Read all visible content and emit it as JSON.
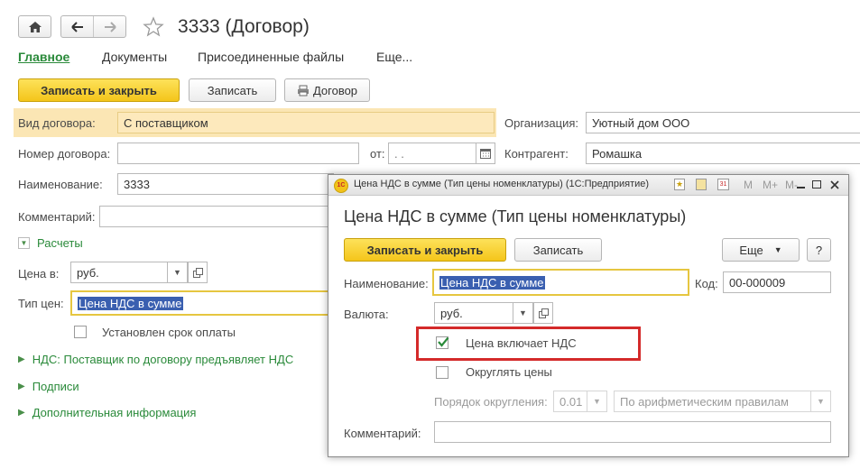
{
  "form": {
    "title": "3333 (Договор)",
    "tabs": [
      "Главное",
      "Документы",
      "Присоединенные файлы",
      "Еще..."
    ],
    "buttons": {
      "save_close": "Записать и закрыть",
      "save": "Записать",
      "contract": "Договор"
    },
    "contract_type_label": "Вид договора:",
    "contract_type_value": "С поставщиком",
    "org_label": "Организация:",
    "org_value": "Уютный дом ООО",
    "number_label": "Номер договора:",
    "number_value": "",
    "from_label": "от:",
    "date_value": " .  .",
    "counterparty_label": "Контрагент:",
    "counterparty_value": "Ромашка",
    "name_label": "Наименование:",
    "name_value": "3333",
    "comment_label": "Комментарий:",
    "payments_section": "Расчеты",
    "price_in_label": "Цена в:",
    "price_in_value": "руб.",
    "price_type_label": "Тип цен:",
    "price_type_value": "Цена НДС в сумме",
    "payment_term_label": "Установлен срок оплаты",
    "vat_section": "НДС: Поставщик по договору предъявляет НДС",
    "signatures_section": "Подписи",
    "extra_section": "Дополнительная информация"
  },
  "dialog": {
    "window_title": "Цена НДС в сумме (Тип цены номенклатуры)  (1С:Предприятие)",
    "heading": "Цена НДС в сумме (Тип цены номенклатуры)",
    "toolbar_m": [
      "M",
      "M+",
      "M-"
    ],
    "buttons": {
      "save_close": "Записать и закрыть",
      "save": "Записать",
      "more": "Еще",
      "help": "?"
    },
    "name_label": "Наименование:",
    "name_value": "Цена НДС в сумме",
    "code_label": "Код:",
    "code_value": "00-000009",
    "currency_label": "Валюта:",
    "currency_value": "руб.",
    "price_includes_vat_label": "Цена включает НДС",
    "price_includes_vat": true,
    "round_prices_label": "Округлять цены",
    "round_prices": false,
    "rounding_order_label": "Порядок округления:",
    "rounding_order_value": "0.01",
    "rounding_rule_value": "По арифметическим правилам",
    "comment_label": "Комментарий:",
    "comment_value": ""
  },
  "colors": {
    "accent_yellow": "#f4c51a",
    "green": "#2a8a3a",
    "highlight_red": "#d42a2a",
    "selection": "#3a5fb0"
  }
}
